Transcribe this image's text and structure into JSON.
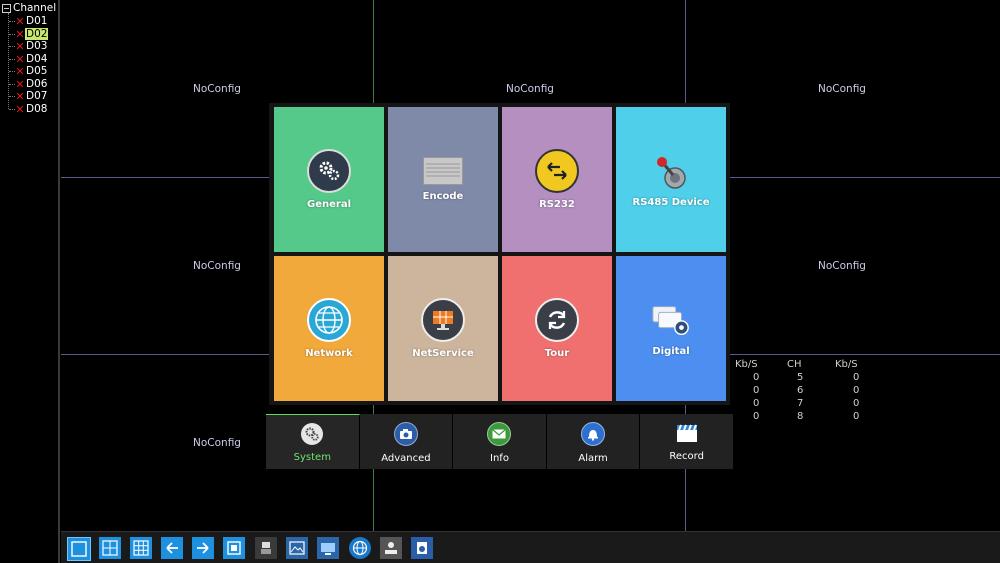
{
  "sidebar": {
    "title": "Channel",
    "channels": [
      "D01",
      "D02",
      "D03",
      "D04",
      "D05",
      "D06",
      "D07",
      "D08"
    ],
    "selected": "D02"
  },
  "grid": {
    "cell_text": "NoConfig",
    "stats": {
      "headers": [
        "Kb/S",
        "CH",
        "Kb/S"
      ],
      "rows": [
        [
          "0",
          "5",
          "0"
        ],
        [
          "0",
          "6",
          "0"
        ],
        [
          "0",
          "7",
          "0"
        ],
        [
          "0",
          "8",
          "0"
        ]
      ]
    }
  },
  "menu": {
    "tiles": [
      {
        "label": "General",
        "color": "#55c98a",
        "icon": "gears-icon"
      },
      {
        "label": "Encode",
        "color": "#7f8aa8",
        "icon": "encode-icon"
      },
      {
        "label": "RS232",
        "color": "#b48fc0",
        "icon": "arrows-icon"
      },
      {
        "label": "RS485 Device",
        "color": "#4fcfe9",
        "icon": "joystick-icon"
      },
      {
        "label": "Network",
        "color": "#f2a93b",
        "icon": "globe-icon"
      },
      {
        "label": "NetService",
        "color": "#cdb59d",
        "icon": "monitor-icon"
      },
      {
        "label": "Tour",
        "color": "#f07070",
        "icon": "refresh-icon"
      },
      {
        "label": "Digital",
        "color": "#4d8ff0",
        "icon": "digital-icon"
      }
    ]
  },
  "tabs": [
    {
      "label": "System",
      "icon": "gears-icon",
      "active": true
    },
    {
      "label": "Advanced",
      "icon": "camera-icon",
      "active": false
    },
    {
      "label": "Info",
      "icon": "mail-icon",
      "active": false
    },
    {
      "label": "Alarm",
      "icon": "bell-icon",
      "active": false
    },
    {
      "label": "Record",
      "icon": "clapper-icon",
      "active": false
    }
  ],
  "toolbar": {
    "buttons": [
      "single-view-icon",
      "quad-view-icon",
      "nine-view-icon",
      "prev-icon",
      "next-icon",
      "fullscreen-icon",
      "ptz-icon",
      "image-icon",
      "monitor-icon",
      "network-icon",
      "user-icon",
      "logout-icon"
    ]
  }
}
